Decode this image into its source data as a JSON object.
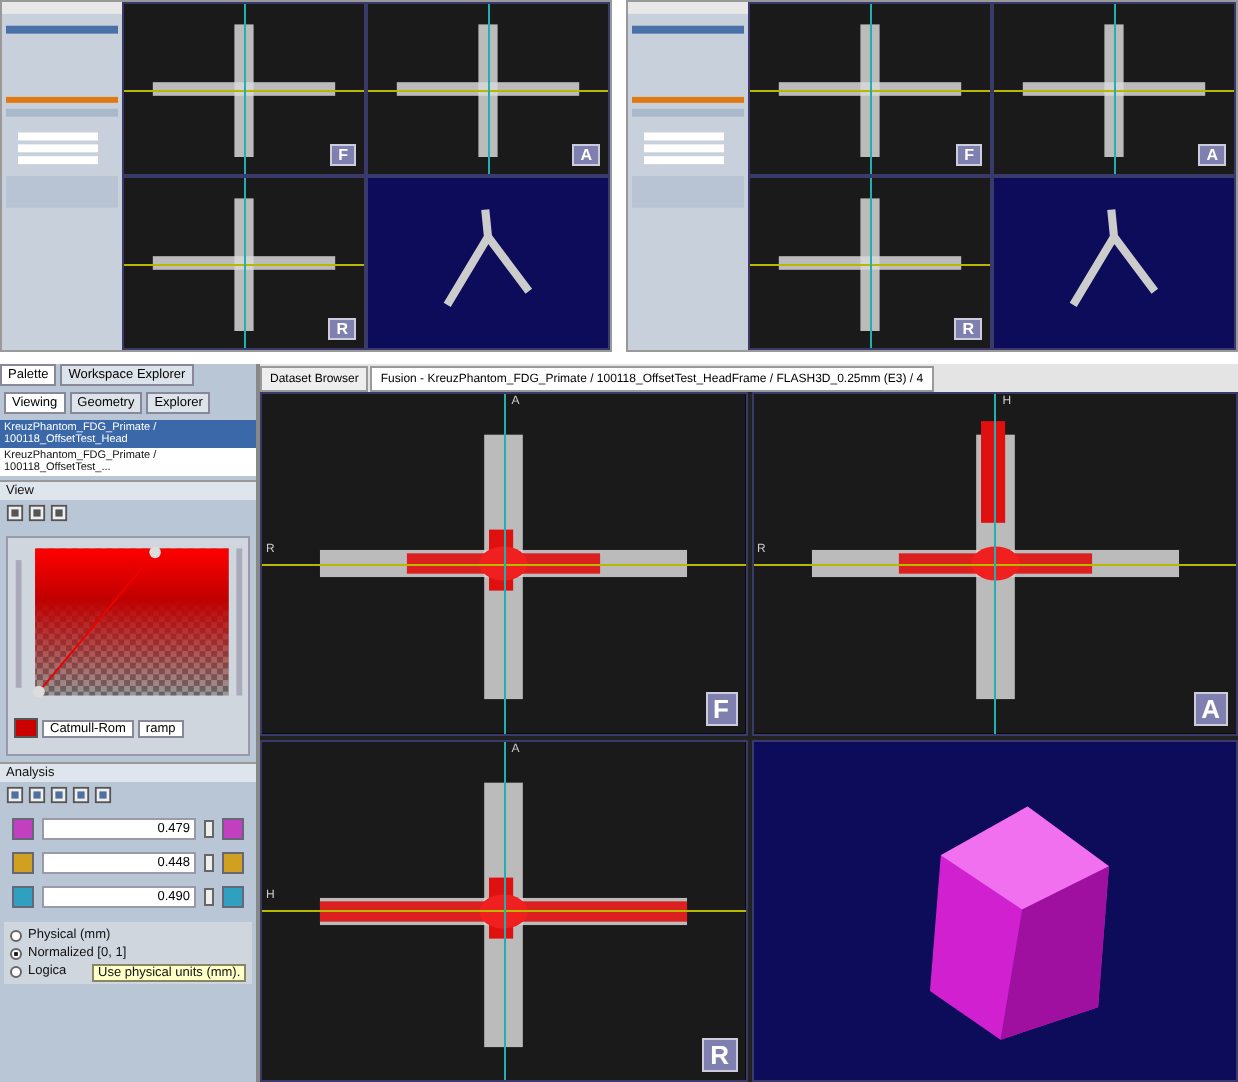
{
  "thumbnails": [
    {
      "views": [
        {
          "kind": "slice",
          "label": "F"
        },
        {
          "kind": "slice",
          "label": "A"
        },
        {
          "kind": "slice",
          "label": "R"
        },
        {
          "kind": "volume"
        }
      ]
    },
    {
      "views": [
        {
          "kind": "slice",
          "label": "F"
        },
        {
          "kind": "slice",
          "label": "A"
        },
        {
          "kind": "slice",
          "label": "R"
        },
        {
          "kind": "volume"
        }
      ]
    }
  ],
  "palette": {
    "tabs": [
      {
        "label": "Palette",
        "selected": true
      },
      {
        "label": "Workspace Explorer",
        "selected": false
      }
    ],
    "subtabs": [
      {
        "label": "Viewing",
        "selected": true
      },
      {
        "label": "Geometry",
        "selected": false
      },
      {
        "label": "Explorer",
        "selected": false
      }
    ],
    "datasets": [
      {
        "label": "KreuzPhantom_FDG_Primate / 100118_OffsetTest_Head",
        "selected": true
      },
      {
        "label": "KreuzPhantom_FDG_Primate / 100118_OffsetTest_...",
        "selected": false
      }
    ],
    "view_section": "View",
    "transfer": {
      "interpolation": "Catmull-Rom",
      "colormap": "ramp"
    },
    "analysis_section": "Analysis",
    "coords": [
      {
        "value": "0.479",
        "color": "#c040c0"
      },
      {
        "value": "0.448",
        "color": "#d0a020"
      },
      {
        "value": "0.490",
        "color": "#30a0c0"
      }
    ],
    "units": [
      {
        "label": "Physical (mm)",
        "selected": false
      },
      {
        "label": "Normalized [0, 1]",
        "selected": true
      },
      {
        "label": "Logica",
        "selected": false
      }
    ],
    "tooltip": "Use physical units (mm)."
  },
  "document_tabs": [
    {
      "label": "Dataset Browser",
      "selected": false
    },
    {
      "label": "Fusion - KreuzPhantom_FDG_Primate / 100118_OffsetTest_HeadFrame / FLASH3D_0.25mm (E3) / 4",
      "selected": true
    }
  ],
  "views": [
    {
      "kind": "slice",
      "label": "F",
      "top": "A",
      "left": "R"
    },
    {
      "kind": "slice",
      "label": "A",
      "top": "H",
      "left": "R"
    },
    {
      "kind": "slice",
      "label": "R",
      "top": "A",
      "left": "H"
    },
    {
      "kind": "volume"
    }
  ]
}
